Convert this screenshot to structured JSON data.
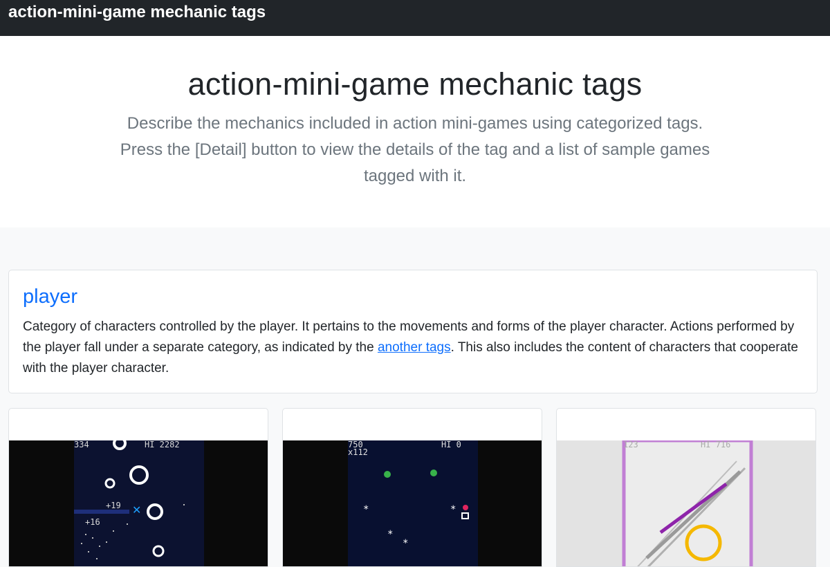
{
  "navbar": {
    "brand": "action-mini-game mechanic tags"
  },
  "hero": {
    "title": "action-mini-game mechanic tags",
    "lead": "Describe the mechanics included in action mini-games using categorized tags. Press the [Detail] button to view the details of the tag and a list of sample games tagged with it."
  },
  "category": {
    "title": "player",
    "desc_before": "Category of characters controlled by the player. It pertains to the movements and forms of the player character. Actions performed by the player fall under a separate category, as indicated by the ",
    "link": "another tags",
    "desc_after": ". This also includes the content of characters that cooperate with the player character."
  },
  "games": [
    {
      "score": "334",
      "hi": "HI 2282",
      "labels": [
        "+19",
        "+16"
      ]
    },
    {
      "score": "750",
      "multiplier": "x112",
      "hi": "HI 0"
    },
    {
      "score": "123",
      "hi": "HI 716"
    }
  ]
}
